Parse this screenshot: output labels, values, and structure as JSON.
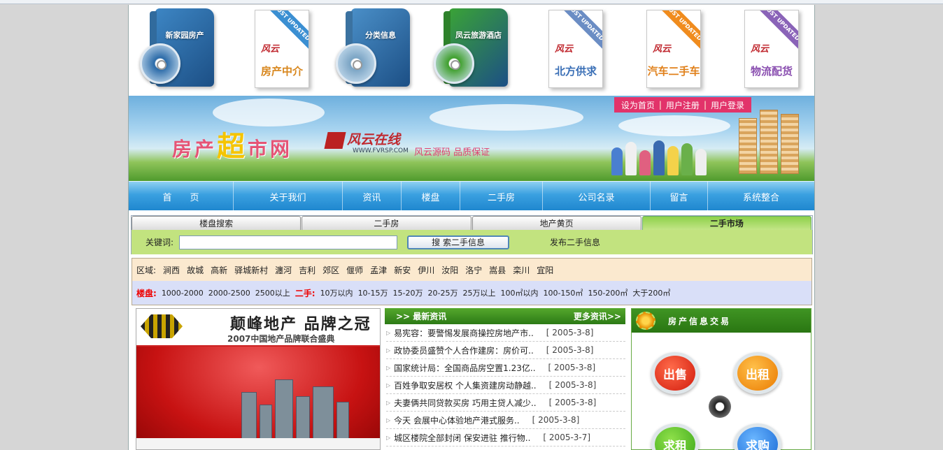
{
  "products": [
    {
      "type": "box",
      "name": "新家园房产",
      "color": "#3d86c4",
      "disc": "#2a6aa8"
    },
    {
      "type": "book",
      "ribbon": "JUST UPDATED",
      "ribbon_color": "#3b8fd2",
      "logo": "风云",
      "title": "房产中介",
      "title_color": "#d8861c"
    },
    {
      "type": "box",
      "name": "分类信息",
      "color": "#4a8fc8",
      "disc": "#7aa4c4"
    },
    {
      "type": "box",
      "name": "凤云旅游酒店",
      "color": "#3aa336",
      "disc": "#3f9f2c"
    },
    {
      "type": "book",
      "ribbon": "JUST UPDATED",
      "ribbon_color": "#6b8dc4",
      "logo": "风云",
      "title": "北方供求",
      "title_color": "#3a6fb6"
    },
    {
      "type": "book",
      "ribbon": "JUST UPDATED",
      "ribbon_color": "#f08c1e",
      "logo": "风云",
      "title": "汽车二手车",
      "title_color": "#e0801a"
    },
    {
      "type": "book",
      "ribbon": "JUST UPDATED",
      "ribbon_color": "#8a63b8",
      "logo": "风云",
      "title": "物流配货",
      "title_color": "#8a4fb0"
    }
  ],
  "banner": {
    "user_links": [
      "设为首页",
      "用户注册",
      "用户登录"
    ],
    "site_title_a": "房产",
    "site_title_b": "超",
    "site_title_c": "市网",
    "brand": "风云在线",
    "brand_url": "WWW.FVRSP.COM",
    "slogan": "风云源码  品质保证"
  },
  "nav": [
    "首　　页",
    "关于我们",
    "资讯",
    "楼盘",
    "二手房",
    "公司名录",
    "留言",
    "系统整合"
  ],
  "search": {
    "tabs": [
      "楼盘搜索",
      "二手房",
      "地产黄页",
      "二手市场"
    ],
    "active_tab": 3,
    "keyword_label": "关键词:",
    "keyword_value": "",
    "button": "搜 索二手信息",
    "publish": "发布二手信息"
  },
  "filter": {
    "area_label": "区域:",
    "areas": [
      "涧西",
      "故城",
      "高新",
      "驿城新村",
      "瀍河",
      "吉利",
      "郊区",
      "偃师",
      "孟津",
      "新安",
      "伊川",
      "汝阳",
      "洛宁",
      "嵩县",
      "栾川",
      "宜阳"
    ],
    "price_label_a": "楼盘:",
    "price_a": [
      "1000-2000",
      "2000-2500",
      "2500以上"
    ],
    "price_label_b": "二手:",
    "price_b": [
      "10万以内",
      "10-15万",
      "15-20万",
      "20-25万",
      "25万以上",
      "100㎡以内",
      "100-150㎡",
      "150-200㎡",
      "大于200㎡"
    ]
  },
  "ad": {
    "title": "颠峰地产 品牌之冠",
    "subtitle": "2007中国地产品牌联合盛典"
  },
  "news": {
    "header": ">> 最新资讯",
    "more": "更多资讯>>",
    "items": [
      {
        "title": "易宪容：要警惕发展商操控房地产市..",
        "date": "[ 2005-3-8]"
      },
      {
        "title": "政协委员盛赞个人合作建房：房价可..",
        "date": "[ 2005-3-8]"
      },
      {
        "title": "国家统计局：全国商品房空置1.23亿..",
        "date": "[ 2005-3-8]"
      },
      {
        "title": "百姓争取安居权 个人集资建房动静越..",
        "date": "[ 2005-3-8]"
      },
      {
        "title": "夫妻俩共同贷款买房 巧用主贷人减少..",
        "date": "[ 2005-3-8]"
      },
      {
        "title": "今天 会展中心体验地产港式服务..",
        "date": "[ 2005-3-8]"
      },
      {
        "title": "城区楼院全部封闭 保安进驻 推行物..",
        "date": "[ 2005-3-7]"
      }
    ]
  },
  "trade": {
    "header": "房产信息交易",
    "buttons": [
      "出售",
      "出租",
      "求租",
      "求购"
    ]
  }
}
